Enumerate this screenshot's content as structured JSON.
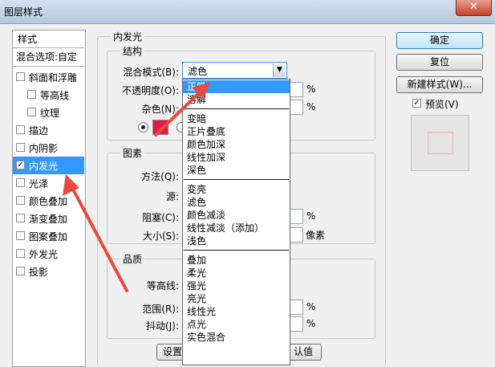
{
  "window": {
    "title": "图层样式",
    "close": "✕"
  },
  "styles_panel": {
    "header": "样式",
    "blend_options": "混合选项:自定",
    "items": [
      {
        "label": "斜面和浮雕",
        "checked": false,
        "selected": false
      },
      {
        "label": "等高线",
        "checked": false,
        "selected": false
      },
      {
        "label": "纹理",
        "checked": false,
        "selected": false
      },
      {
        "label": "描边",
        "checked": false,
        "selected": false
      },
      {
        "label": "内阴影",
        "checked": false,
        "selected": false
      },
      {
        "label": "内发光",
        "checked": true,
        "selected": true
      },
      {
        "label": "光泽",
        "checked": false,
        "selected": false
      },
      {
        "label": "颜色叠加",
        "checked": false,
        "selected": false
      },
      {
        "label": "渐变叠加",
        "checked": false,
        "selected": false
      },
      {
        "label": "图案叠加",
        "checked": false,
        "selected": false
      },
      {
        "label": "外发光",
        "checked": false,
        "selected": false
      },
      {
        "label": "投影",
        "checked": false,
        "selected": false
      }
    ]
  },
  "inner_glow": {
    "title": "内发光",
    "structure": {
      "title": "结构",
      "blend_mode_label": "混合模式(B):",
      "blend_mode_value": "滤色",
      "opacity_label": "不透明度(O):",
      "opacity_unit": "%",
      "noise_label": "杂色(N):",
      "noise_unit": "%"
    },
    "elements": {
      "title": "图素",
      "method_label": "方法(Q):",
      "source_label": "源:",
      "choke_label": "阻塞(C):",
      "choke_unit": "%",
      "size_label": "大小(S):",
      "size_unit": "像素"
    },
    "quality": {
      "title": "品质",
      "contour_label": "等高线:",
      "range_label": "范围(R):",
      "range_unit": "%",
      "jitter_label": "抖动(J):",
      "jitter_unit": "%"
    },
    "bottom_left_button": "设置",
    "bottom_right_button": "认值"
  },
  "blend_mode_dropdown": {
    "groups": [
      [
        "正常",
        "溶解"
      ],
      [
        "变暗",
        "正片叠底",
        "颜色加深",
        "线性加深",
        "深色"
      ],
      [
        "变亮",
        "滤色",
        "颜色减淡",
        "线性减淡（添加）",
        "浅色"
      ],
      [
        "叠加",
        "柔光",
        "强光",
        "亮光",
        "线性光",
        "点光",
        "实色混合"
      ]
    ],
    "highlighted": "正常"
  },
  "side_buttons": {
    "ok": "确定",
    "reset": "复位",
    "new_style": "新建样式(W)...",
    "preview_label": "预览(V)",
    "preview_checked": true
  },
  "colors": {
    "glow_swatch": "#e8174a",
    "selection": "#3399ff",
    "annotation_arrow": "#e84a3c"
  }
}
